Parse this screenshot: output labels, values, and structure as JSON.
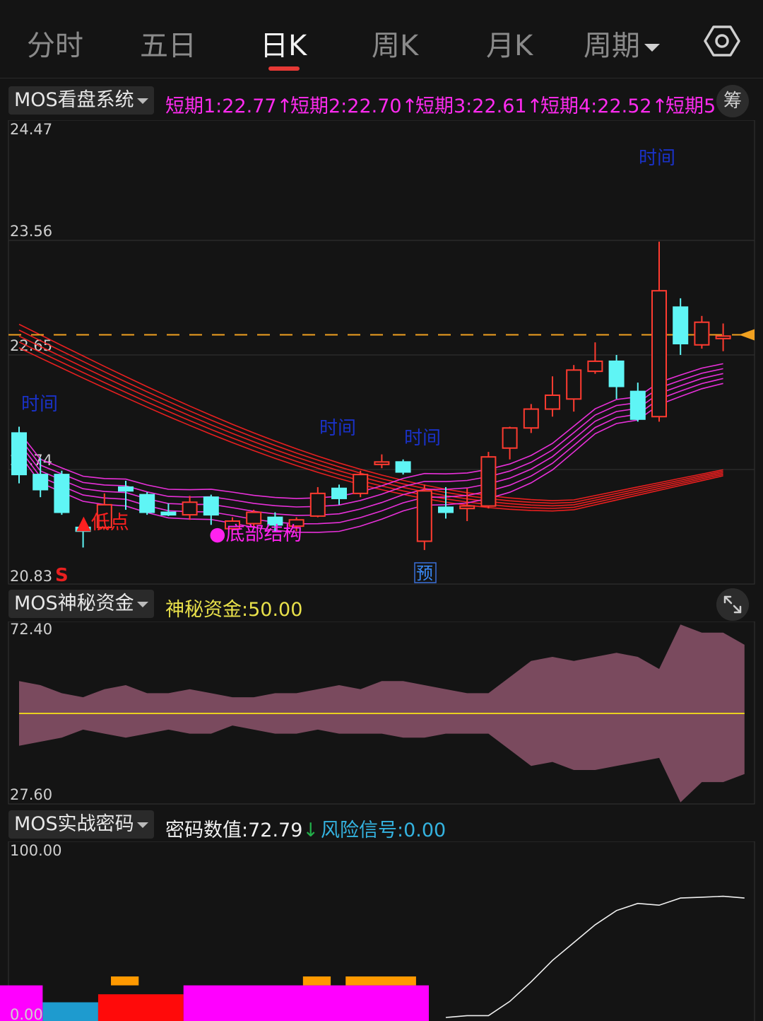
{
  "tabs": [
    {
      "label": "分时",
      "active": false
    },
    {
      "label": "五日",
      "active": false
    },
    {
      "label": "日K",
      "active": true
    },
    {
      "label": "周K",
      "active": false
    },
    {
      "label": "月K",
      "active": false
    },
    {
      "label": "周期",
      "active": false,
      "dropdown": true
    }
  ],
  "settings_icon": "gear-hexagon-icon",
  "main_panel": {
    "indicator": "MOS看盘系统",
    "legend": [
      {
        "label": "短期1:22.77↑",
        "color": "#ff2bf0"
      },
      {
        "label": "短期2:22.70↑",
        "color": "#ff2bf0"
      },
      {
        "label": "短期3:22.61↑",
        "color": "#ff2bf0"
      },
      {
        "label": "短期4:22.52↑",
        "color": "#ff2bf0"
      },
      {
        "label": "短期5",
        "color": "#ff2bf0"
      }
    ],
    "chip_button": "筹",
    "y_ticks": [
      "24.47",
      "23.56",
      "22.65",
      "21.74",
      "20.83"
    ],
    "signal_s": "S",
    "annotations": {
      "low": "▲低点",
      "bottom": "●底部结构",
      "time": "时间",
      "pre": "预"
    },
    "colors": {
      "up": "#ff3b30",
      "down": "#5ff5f5",
      "long_ma": "#ff2020",
      "short_ma": "#ff33ee",
      "price_line": "#f0a020"
    }
  },
  "chart_data": [
    {
      "type": "candlestick",
      "y_range": [
        20.83,
        24.47
      ],
      "candles": [
        {
          "o": 22.03,
          "h": 22.08,
          "l": 21.63,
          "c": 21.7
        },
        {
          "o": 21.7,
          "h": 21.83,
          "l": 21.52,
          "c": 21.58
        },
        {
          "o": 21.7,
          "h": 21.73,
          "l": 21.38,
          "c": 21.4
        },
        {
          "o": 21.28,
          "h": 21.3,
          "l": 21.12,
          "c": 21.25
        },
        {
          "o": 21.28,
          "h": 21.55,
          "l": 21.27,
          "c": 21.46
        },
        {
          "o": 21.6,
          "h": 21.65,
          "l": 21.42,
          "c": 21.57
        },
        {
          "o": 21.54,
          "h": 21.56,
          "l": 21.38,
          "c": 21.4
        },
        {
          "o": 21.4,
          "h": 21.47,
          "l": 21.37,
          "c": 21.38
        },
        {
          "o": 21.38,
          "h": 21.53,
          "l": 21.34,
          "c": 21.48
        },
        {
          "o": 21.52,
          "h": 21.54,
          "l": 21.3,
          "c": 21.38
        },
        {
          "o": 21.27,
          "h": 21.36,
          "l": 21.24,
          "c": 21.33
        },
        {
          "o": 21.31,
          "h": 21.42,
          "l": 21.28,
          "c": 21.4
        },
        {
          "o": 21.36,
          "h": 21.4,
          "l": 21.24,
          "c": 21.3
        },
        {
          "o": 21.29,
          "h": 21.36,
          "l": 21.25,
          "c": 21.34
        },
        {
          "o": 21.37,
          "h": 21.6,
          "l": 21.36,
          "c": 21.55
        },
        {
          "o": 21.59,
          "h": 21.62,
          "l": 21.46,
          "c": 21.51
        },
        {
          "o": 21.55,
          "h": 21.73,
          "l": 21.52,
          "c": 21.7
        },
        {
          "o": 21.78,
          "h": 21.86,
          "l": 21.75,
          "c": 21.8
        },
        {
          "o": 21.8,
          "h": 21.82,
          "l": 21.7,
          "c": 21.72
        },
        {
          "o": 21.17,
          "h": 21.62,
          "l": 21.1,
          "c": 21.57
        },
        {
          "o": 21.44,
          "h": 21.6,
          "l": 21.35,
          "c": 21.4
        },
        {
          "o": 21.43,
          "h": 21.59,
          "l": 21.33,
          "c": 21.45
        },
        {
          "o": 21.45,
          "h": 21.88,
          "l": 21.43,
          "c": 21.84
        },
        {
          "o": 21.91,
          "h": 22.08,
          "l": 21.82,
          "c": 22.07
        },
        {
          "o": 22.07,
          "h": 22.26,
          "l": 22.03,
          "c": 22.22
        },
        {
          "o": 22.22,
          "h": 22.48,
          "l": 22.16,
          "c": 22.33
        },
        {
          "o": 22.3,
          "h": 22.57,
          "l": 22.2,
          "c": 22.53
        },
        {
          "o": 22.52,
          "h": 22.75,
          "l": 22.5,
          "c": 22.6
        },
        {
          "o": 22.6,
          "h": 22.65,
          "l": 22.3,
          "c": 22.4
        },
        {
          "o": 22.36,
          "h": 22.43,
          "l": 22.12,
          "c": 22.14
        },
        {
          "o": 22.16,
          "h": 23.55,
          "l": 22.12,
          "c": 23.16
        },
        {
          "o": 23.03,
          "h": 23.1,
          "l": 22.65,
          "c": 22.74
        },
        {
          "o": 22.73,
          "h": 22.96,
          "l": 22.7,
          "c": 22.91
        },
        {
          "o": 22.78,
          "h": 22.9,
          "l": 22.68,
          "c": 22.8
        }
      ],
      "current_price_line": 22.81
    },
    {
      "type": "area",
      "title": "MOS神秘资金",
      "legend": "神秘资金:50.00",
      "y_range": [
        27.6,
        72.4
      ],
      "baseline": 50.0,
      "upper": [
        58,
        57,
        55,
        54,
        56,
        57,
        55,
        55,
        56,
        55,
        54,
        54,
        55,
        55,
        56,
        57,
        56,
        58,
        58,
        57,
        56,
        55,
        55,
        59,
        63,
        64,
        63,
        64,
        65,
        64,
        61,
        72,
        70,
        70,
        67
      ],
      "lower": [
        42,
        43,
        44,
        46,
        45,
        44,
        45,
        46,
        45,
        45,
        47,
        46,
        45,
        45,
        46,
        45,
        45,
        45,
        44,
        44,
        45,
        45,
        45,
        41,
        37,
        38,
        36,
        36,
        37,
        38,
        39,
        28,
        33,
        33,
        35
      ]
    },
    {
      "type": "bar+line",
      "title": "MOS实战密码",
      "legend": [
        {
          "label": "密码数值:72.79",
          "arrow": "↓",
          "arrow_color": "#22b04a",
          "color": "#f0f0f0"
        },
        {
          "label": "风险信号:0.00",
          "color": "#34b3e0"
        }
      ],
      "y_range": [
        0,
        100
      ],
      "y_ticks": [
        "100.00",
        "0.00"
      ],
      "bars": [
        {
          "x0": 0,
          "x1": 2,
          "v": 20,
          "color": "#ff00ff"
        },
        {
          "x0": 2,
          "x1": 4.6,
          "v": 10.5,
          "color": "#1e9bcf"
        },
        {
          "x0": 4.6,
          "x1": 8.6,
          "v": 15,
          "color": "#ff0a0a"
        },
        {
          "x0": 8.6,
          "x1": 20.1,
          "v": 20,
          "color": "#ff00ff"
        },
        {
          "x0": 5.2,
          "x1": 6.5,
          "v": 25,
          "color": "#ff9900"
        },
        {
          "x0": 14.2,
          "x1": 15.5,
          "v": 25,
          "color": "#ff9900"
        },
        {
          "x0": 16.2,
          "x1": 19.5,
          "v": 25,
          "color": "#ff9900"
        }
      ],
      "line": [
        [
          20,
          2
        ],
        [
          21,
          3
        ],
        [
          22,
          3
        ],
        [
          23,
          11
        ],
        [
          24,
          22
        ],
        [
          25,
          34
        ],
        [
          26,
          44
        ],
        [
          27,
          54
        ],
        [
          28,
          62
        ],
        [
          29,
          66
        ],
        [
          30,
          65
        ],
        [
          31,
          69
        ],
        [
          32,
          69.5
        ],
        [
          33,
          70
        ],
        [
          34,
          69
        ]
      ]
    }
  ],
  "sub_panel_1": {
    "indicator": "MOS神秘资金",
    "legend": "神秘资金:50.00",
    "y_ticks": [
      "72.40",
      "27.60"
    ],
    "expand_icon": "expand-arrows-icon"
  },
  "sub_panel_2": {
    "indicator": "MOS实战密码"
  }
}
